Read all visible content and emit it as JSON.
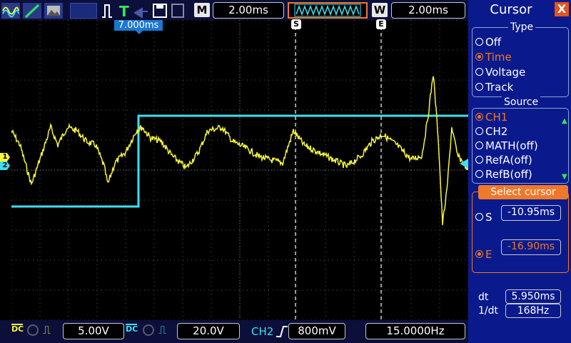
{
  "colors": {
    "ch1": "#f8f53a",
    "ch2": "#3de0f0",
    "accent": "#f0782a",
    "panel": "#0a1a8c"
  },
  "top": {
    "timebase_label": "M",
    "timebase": "2.00ms",
    "window_label": "W",
    "window": "2.00ms",
    "trigger_pos": "7.000ms"
  },
  "cursor_markers": {
    "s": "S",
    "e": "E"
  },
  "channel_markers": {
    "ch1": "1",
    "ch2": "2"
  },
  "bottom": {
    "ch1_coupling": "DC",
    "ch1_scale": "5.00V",
    "ch2_coupling": "DC",
    "ch2_scale": "20.0V",
    "trigger_source": "CH2",
    "trigger_level": "800mV",
    "frequency": "15.0000Hz"
  },
  "panel": {
    "title": "Cursor",
    "close": "X",
    "type_title": "Type",
    "type_options": [
      "Off",
      "Time",
      "Voltage",
      "Track"
    ],
    "type_selected": "Time",
    "source_title": "Source",
    "source_options": [
      "CH1",
      "CH2",
      "MATH(off)",
      "RefA(off)",
      "RefB(off)"
    ],
    "source_selected": "CH1",
    "select_cursor_label": "Select cursor",
    "s_label": "S",
    "s_value": "-10.95ms",
    "e_label": "E",
    "e_value": "-16.90ms",
    "dt_label": "dt",
    "dt_value": "5.950ms",
    "inv_dt_label": "1/dt",
    "inv_dt_value": "168Hz"
  }
}
